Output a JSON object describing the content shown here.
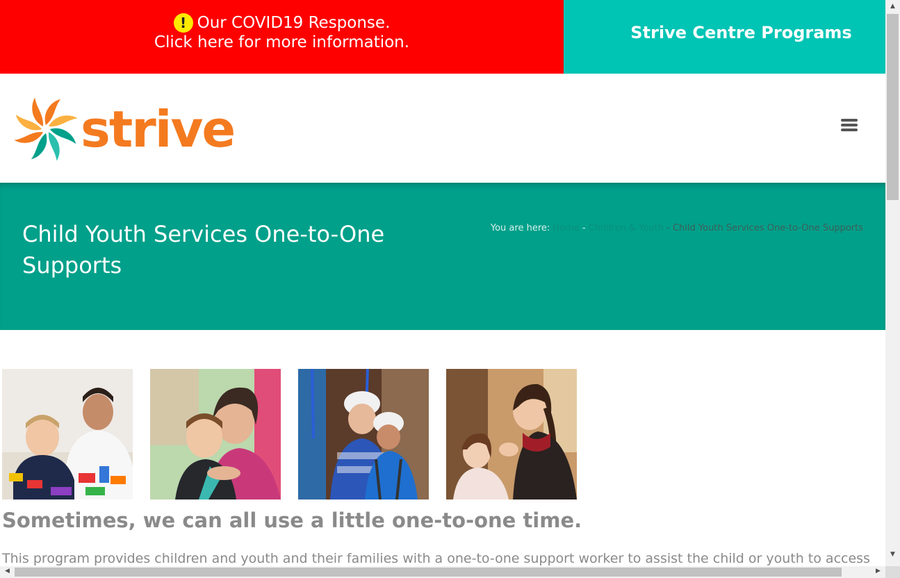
{
  "banner": {
    "covid_line1": "Our COVID19 Response.",
    "covid_line2": "Click here for more information.",
    "alert_glyph": "!",
    "programs_label": "Strive Centre Programs"
  },
  "header": {
    "logo_text": "strive",
    "menu_icon": "hamburger-menu-icon"
  },
  "hero": {
    "title": "Child Youth Services One-to-One Supports",
    "breadcrumb": {
      "prefix": "You are here:",
      "home": "Home",
      "sep1": " - ",
      "category": "Children & Youth",
      "sep2": " - ",
      "current": "Child Youth Services One-to-One Supports"
    }
  },
  "content": {
    "heading": "Sometimes, we can all use a little one-to-one time.",
    "paragraph": "This program provides children and youth and their families with a one-to-one support worker to assist the child or youth to access"
  },
  "colors": {
    "covid_red": "#ff0000",
    "programs_teal": "#00c4b4",
    "hero_teal": "#00a08a",
    "logo_orange": "#f47a1f"
  }
}
